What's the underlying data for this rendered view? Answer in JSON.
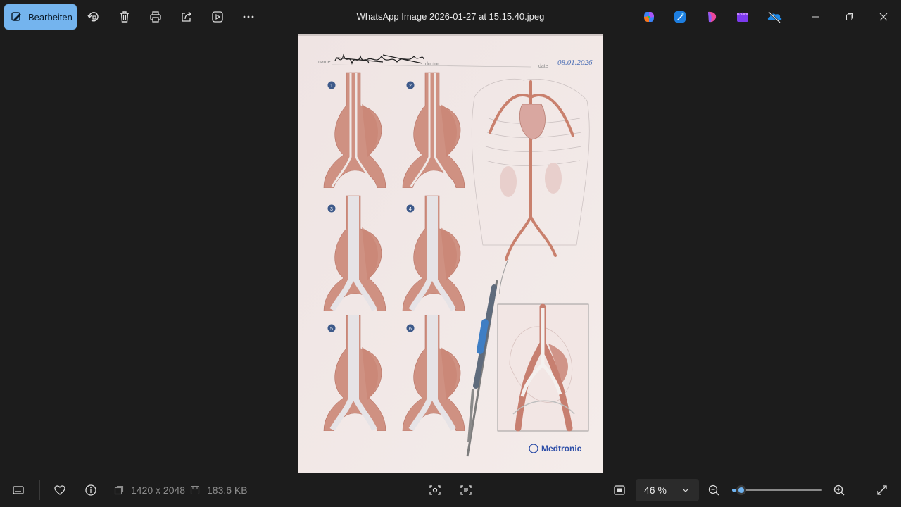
{
  "toolbar": {
    "edit_label": "Bearbeiten",
    "title": "WhatsApp Image 2026-01-27 at 15.15.40.jpeg",
    "accent_color": "#74b4ee"
  },
  "icons": {
    "rotate": "rotate-icon",
    "delete": "trash-icon",
    "print": "print-icon",
    "share": "share-icon",
    "slideshow": "slideshow-icon",
    "more": "more-icon",
    "copilot": "copilot-icon",
    "designer": "designer-icon",
    "paint": "paint-icon",
    "clipchamp": "clipchamp-icon",
    "onedrive": "onedrive-icon"
  },
  "document": {
    "name_label": "name",
    "doctor_label": "doctor",
    "date_label": "date",
    "date_value": "08.01.2026",
    "steps": [
      "1",
      "2",
      "3",
      "4",
      "5",
      "6"
    ],
    "brand": "Medtronic"
  },
  "statusbar": {
    "dimensions": "1420 x 2048",
    "filesize": "183.6 KB",
    "zoom_label": "46 %",
    "zoom_fraction": 0.05
  }
}
